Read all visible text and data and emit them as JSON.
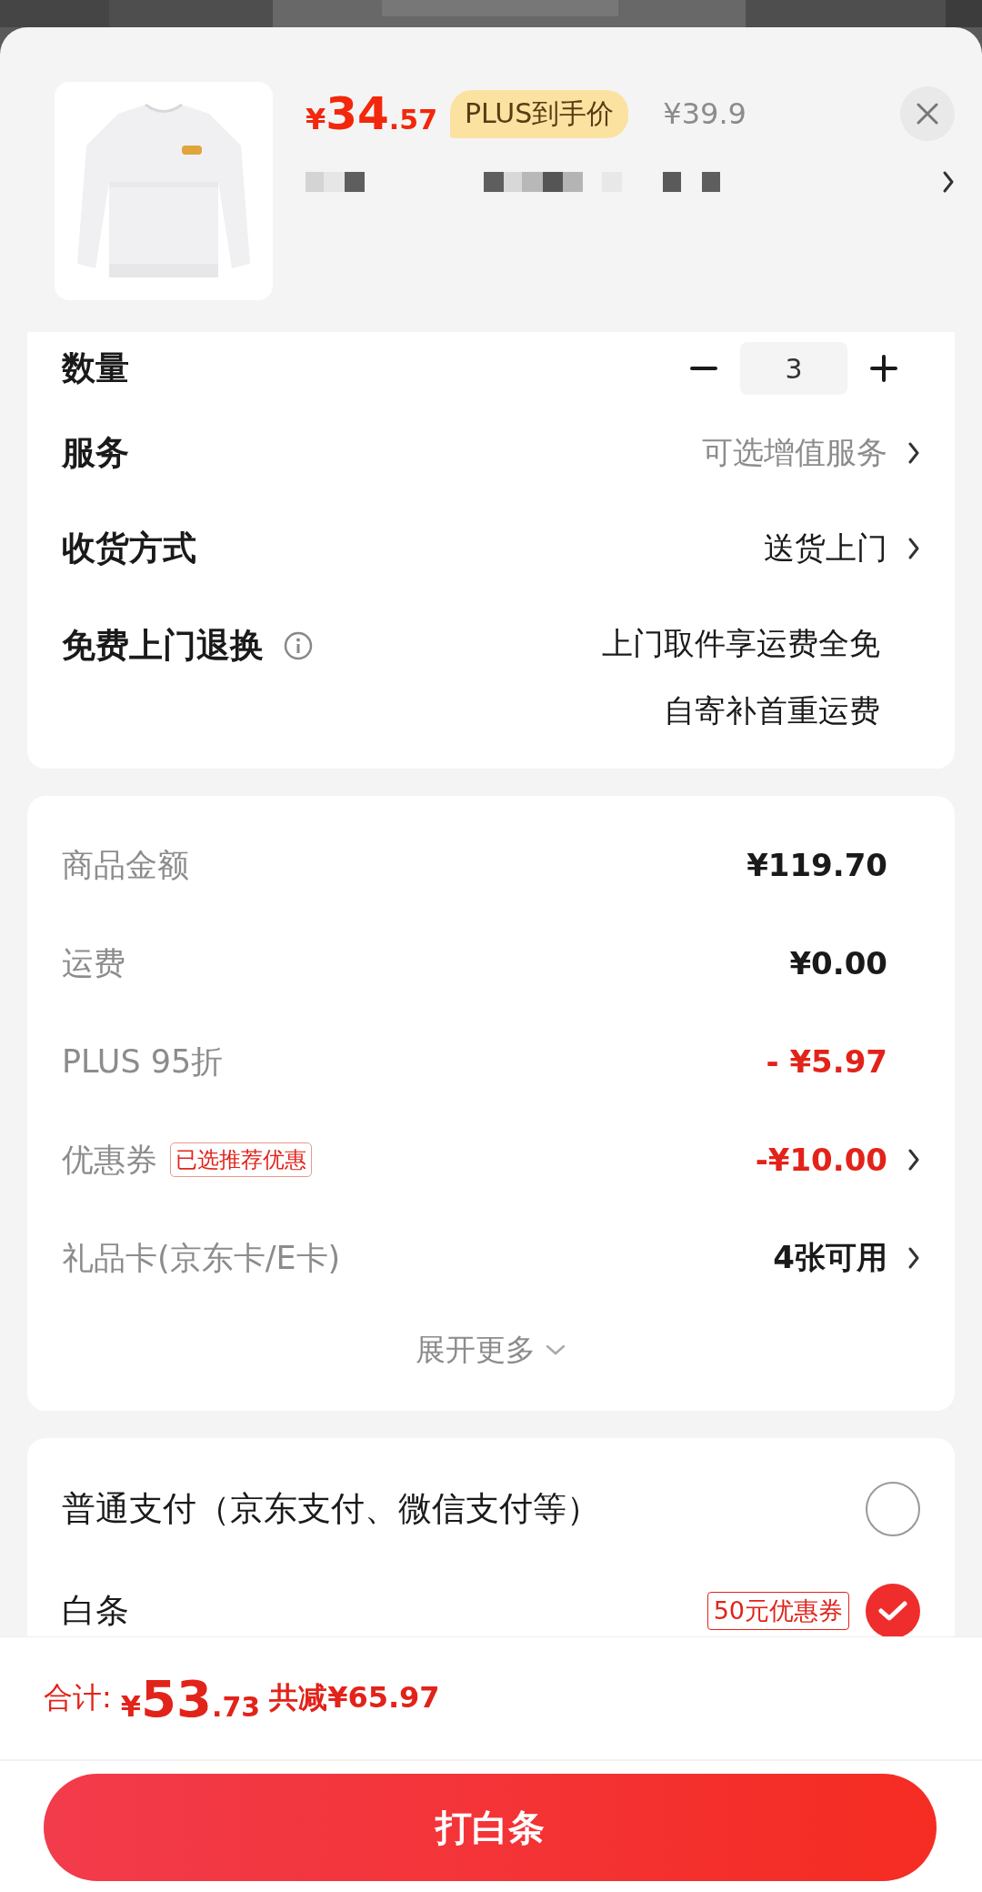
{
  "product": {
    "kind": "picture",
    "price_symbol": "¥",
    "price_int": "34",
    "price_dec": ".57",
    "badge": "PLUS到手价",
    "original_price": "¥39.9"
  },
  "order_rows": [
    {
      "kind": "stepper",
      "label": "数量",
      "value": "3"
    },
    {
      "kind": "link",
      "label": "服务",
      "value": "可选增值服务",
      "muted": true
    },
    {
      "kind": "link",
      "label": "收货方式",
      "value": "送货上门",
      "muted": false
    },
    {
      "kind": "info",
      "label": "免费上门退换",
      "lines": [
        "上门取件享运费全免",
        "自寄补首重运费"
      ]
    }
  ],
  "amounts": {
    "rows": [
      {
        "label": "商品金额",
        "value": "¥119.70",
        "discount": false,
        "arrow": false
      },
      {
        "label": "运费",
        "value": "¥0.00",
        "discount": false,
        "arrow": false
      },
      {
        "label": "PLUS 95折",
        "value": "- ¥5.97",
        "discount": true,
        "arrow": false
      },
      {
        "label": "优惠券",
        "tag": "已选推荐优惠",
        "value": "-¥10.00",
        "discount": true,
        "arrow": true
      },
      {
        "label": "礼品卡(京东卡/E卡)",
        "value": "4张可用",
        "discount": false,
        "arrow": true
      }
    ],
    "expand": "展开更多"
  },
  "payments": [
    {
      "label": "普通支付（京东支付、微信支付等）",
      "selected": false
    },
    {
      "label": "白条",
      "tag": "50元优惠券",
      "selected": true
    }
  ],
  "footer": {
    "total_label": "合计:",
    "symbol": "¥",
    "int": "53",
    "dec": ".73",
    "saved": "共减¥65.97",
    "button": "打白条"
  }
}
